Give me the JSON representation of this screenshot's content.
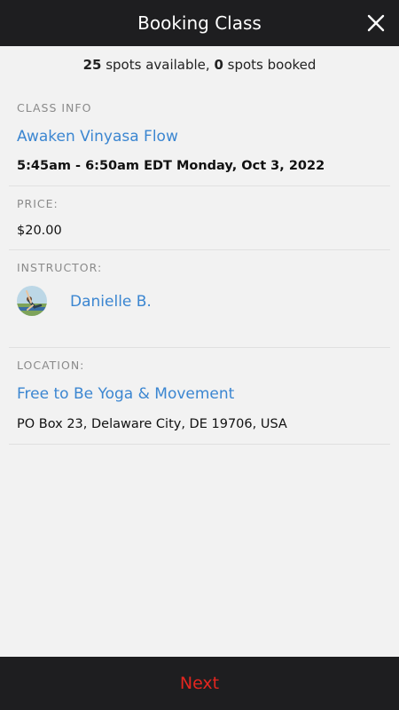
{
  "header": {
    "title": "Booking Class"
  },
  "spots": {
    "available_count": "25",
    "available_text": " spots available, ",
    "booked_count": "0",
    "booked_text": " spots booked"
  },
  "class_info": {
    "label": "CLASS INFO",
    "name": "Awaken Vinyasa Flow",
    "datetime": "5:45am - 6:50am EDT Monday, Oct 3, 2022"
  },
  "price": {
    "label": "PRICE:",
    "value": "$20.00"
  },
  "instructor": {
    "label": "INSTRUCTOR:",
    "name": "Danielle B."
  },
  "location": {
    "label": "LOCATION:",
    "name": "Free to Be Yoga & Movement",
    "address": "PO Box 23, Delaware City, DE 19706, USA"
  },
  "footer": {
    "next_label": "Next"
  },
  "colors": {
    "header_bg": "#1e1e20",
    "link": "#3b86d1",
    "next": "#e3261f"
  }
}
